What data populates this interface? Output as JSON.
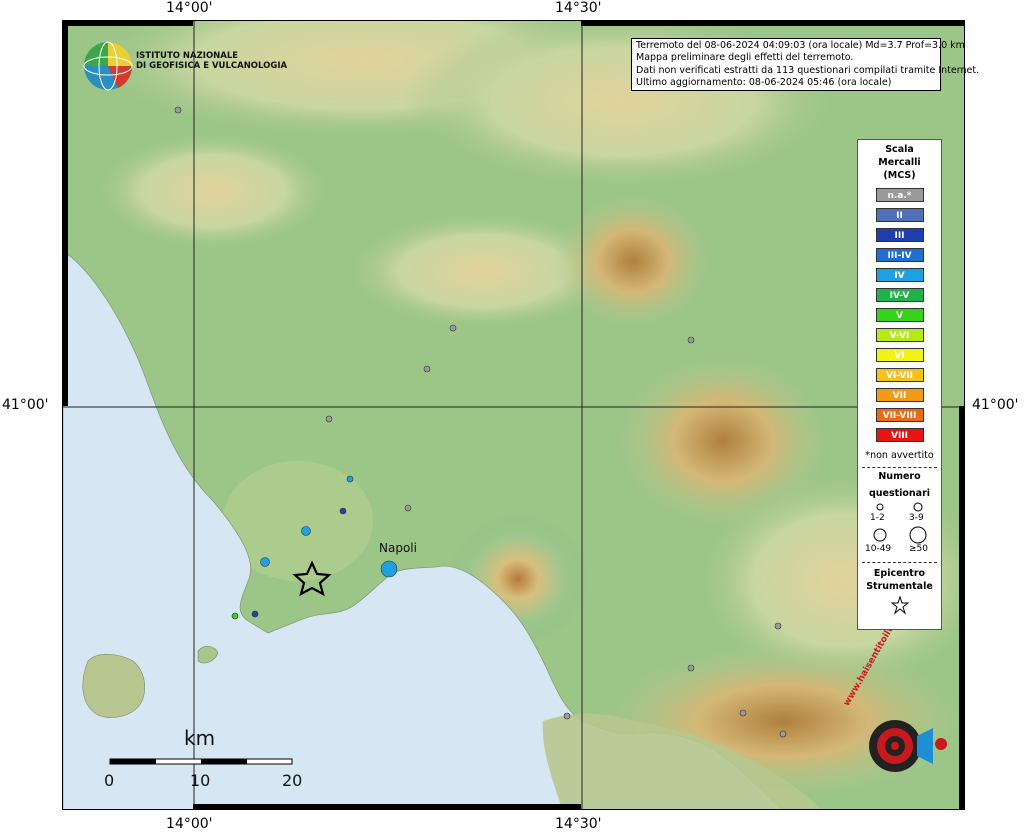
{
  "map": {
    "coords": {
      "top_left_lon": "14°00'",
      "top_right_lon": "14°30'",
      "bottom_left_lon": "14°00'",
      "bottom_right_lon": "14°30'",
      "left_lat": "41°00'",
      "right_lat": "41°00'"
    },
    "logo": {
      "line1": "ISTITUTO NAZIONALE",
      "line2": "DI GEOFISICA E VULCANOLOGIA"
    },
    "info": {
      "line1": "Terremoto del 08-06-2024 04:09:03 (ora locale) Md=3.7 Prof=3.0 km",
      "line2": "Mappa preliminare degli effetti del terremoto.",
      "line3": "Dati non verificati estratti da 113 questionari compilati tramite Internet.",
      "line4": "Ultimo aggiornamento: 08-06-2024 05:46 (ora locale)"
    },
    "city_label": "Napoli",
    "scale": {
      "unit": "km",
      "ticks": [
        "0",
        "10",
        "20"
      ]
    },
    "watermark": "www.haisentitoilterremoto.it"
  },
  "legend": {
    "title_line1": "Scala",
    "title_line2": "Mercalli",
    "title_line3": "(MCS)",
    "intensities": [
      {
        "label": "n.a.*",
        "color": "#9a9a9a"
      },
      {
        "label": "II",
        "color": "#4f6fb6"
      },
      {
        "label": "III",
        "color": "#1f3fb0"
      },
      {
        "label": "III-IV",
        "color": "#1e6fd0"
      },
      {
        "label": "IV",
        "color": "#1fa0e0"
      },
      {
        "label": "IV-V",
        "color": "#22b24c"
      },
      {
        "label": "V",
        "color": "#33d41a"
      },
      {
        "label": "V-VI",
        "color": "#b4ea1a"
      },
      {
        "label": "VI",
        "color": "#f2f219"
      },
      {
        "label": "VI-VII",
        "color": "#f5c21c"
      },
      {
        "label": "VII",
        "color": "#f59a17"
      },
      {
        "label": "VII-VIII",
        "color": "#ee6a12"
      },
      {
        "label": "VIII",
        "color": "#e81414"
      }
    ],
    "note": "*non avvertito",
    "count_title_line1": "Numero",
    "count_title_line2": "questionari",
    "count_classes": [
      "1-2",
      "3-9",
      "10-49",
      "≥50"
    ],
    "epicenter_title_line1": "Epicentro",
    "epicenter_title_line2": "Strumentale"
  },
  "observations": [
    {
      "intensity": "n.a.*",
      "size_class": "1-2"
    },
    {
      "intensity": "n.a.*",
      "size_class": "1-2"
    },
    {
      "intensity": "n.a.*",
      "size_class": "1-2"
    },
    {
      "intensity": "n.a.*",
      "size_class": "1-2"
    },
    {
      "intensity": "n.a.*",
      "size_class": "1-2"
    },
    {
      "intensity": "n.a.*",
      "size_class": "1-2"
    },
    {
      "intensity": "n.a.*",
      "size_class": "1-2"
    },
    {
      "intensity": "n.a.*",
      "size_class": "1-2"
    },
    {
      "intensity": "n.a.*",
      "size_class": "1-2"
    },
    {
      "intensity": "n.a.*",
      "size_class": "1-2"
    },
    {
      "intensity": "n.a.*",
      "size_class": "1-2"
    },
    {
      "intensity": "IV",
      "size_class": "1-2"
    },
    {
      "intensity": "III",
      "size_class": "1-2"
    },
    {
      "intensity": "IV",
      "size_class": "3-9"
    },
    {
      "intensity": "IV",
      "size_class": "3-9"
    },
    {
      "intensity": "IV",
      "size_class": "≥50"
    },
    {
      "intensity": "V",
      "size_class": "1-2"
    },
    {
      "intensity": "III",
      "size_class": "1-2"
    }
  ]
}
